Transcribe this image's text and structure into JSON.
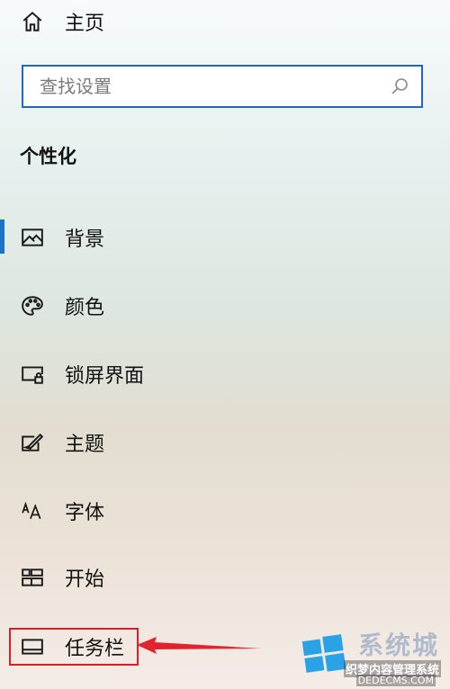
{
  "nav": {
    "home_label": "主页"
  },
  "search": {
    "placeholder": "查找设置"
  },
  "section_title": "个性化",
  "items": [
    {
      "label": "背景",
      "icon": "picture-icon",
      "selected": true
    },
    {
      "label": "颜色",
      "icon": "palette-icon"
    },
    {
      "label": "锁屏界面",
      "icon": "lock-screen-icon"
    },
    {
      "label": "主题",
      "icon": "theme-brush-icon"
    },
    {
      "label": "字体",
      "icon": "font-icon"
    },
    {
      "label": "开始",
      "icon": "start-tiles-icon"
    },
    {
      "label": "任务栏",
      "icon": "taskbar-icon",
      "highlighted": true
    }
  ],
  "watermark": {
    "line1": "系统城",
    "line2": "织梦内容管理系统",
    "line3": "DEDECMS.COM"
  },
  "colors": {
    "accent": "#1a73c9",
    "highlight": "#d3212b",
    "search_border": "#1f6ab8"
  }
}
